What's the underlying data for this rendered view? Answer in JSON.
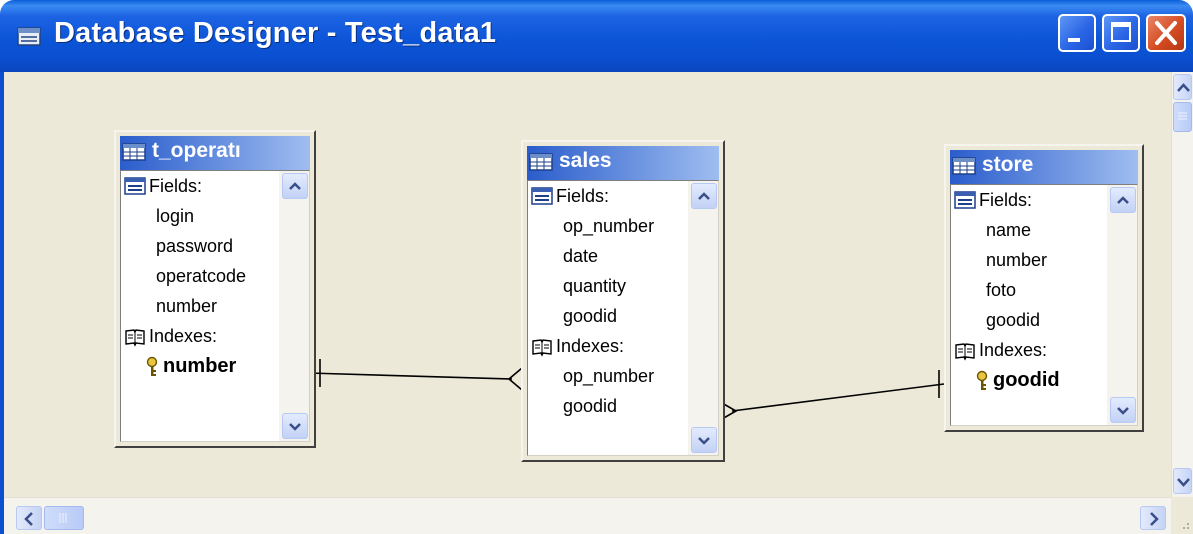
{
  "window": {
    "title": "Database Designer - Test_data1",
    "controls": {
      "minimize": "minimize",
      "maximize": "maximize",
      "close": "close"
    }
  },
  "tables": [
    {
      "name": "t_operatı",
      "fields_label": "Fields:",
      "fields": [
        "login",
        "password",
        "operatcode",
        "number"
      ],
      "indexes_label": "Indexes:",
      "indexes": [
        {
          "name": "number",
          "primary": true
        }
      ]
    },
    {
      "name": "sales",
      "fields_label": "Fields:",
      "fields": [
        "op_number",
        "date",
        "quantity",
        "goodid"
      ],
      "indexes_label": "Indexes:",
      "indexes": [
        {
          "name": "op_number",
          "primary": false
        },
        {
          "name": "goodid",
          "primary": false
        }
      ]
    },
    {
      "name": "store",
      "fields_label": "Fields:",
      "fields": [
        "name",
        "number",
        "foto",
        "goodid"
      ],
      "indexes_label": "Indexes:",
      "indexes": [
        {
          "name": "goodid",
          "primary": true
        }
      ]
    }
  ],
  "relations": [
    {
      "from": "t_operatı",
      "to": "sales",
      "from_end": "one",
      "to_end": "many"
    },
    {
      "from": "sales",
      "to": "store",
      "from_end": "many",
      "to_end": "one"
    }
  ],
  "icons": {
    "title": "database-designer-icon",
    "table": "table-icon",
    "fields": "fields-icon",
    "indexes": "indexes-book-icon",
    "primary_key": "key-icon"
  },
  "colors": {
    "title_bar": "#0c55d8",
    "table_title_start": "#2a5dcc",
    "table_title_end": "#9fbdf0",
    "canvas": "#ece9d8",
    "close_button": "#d54c22"
  }
}
